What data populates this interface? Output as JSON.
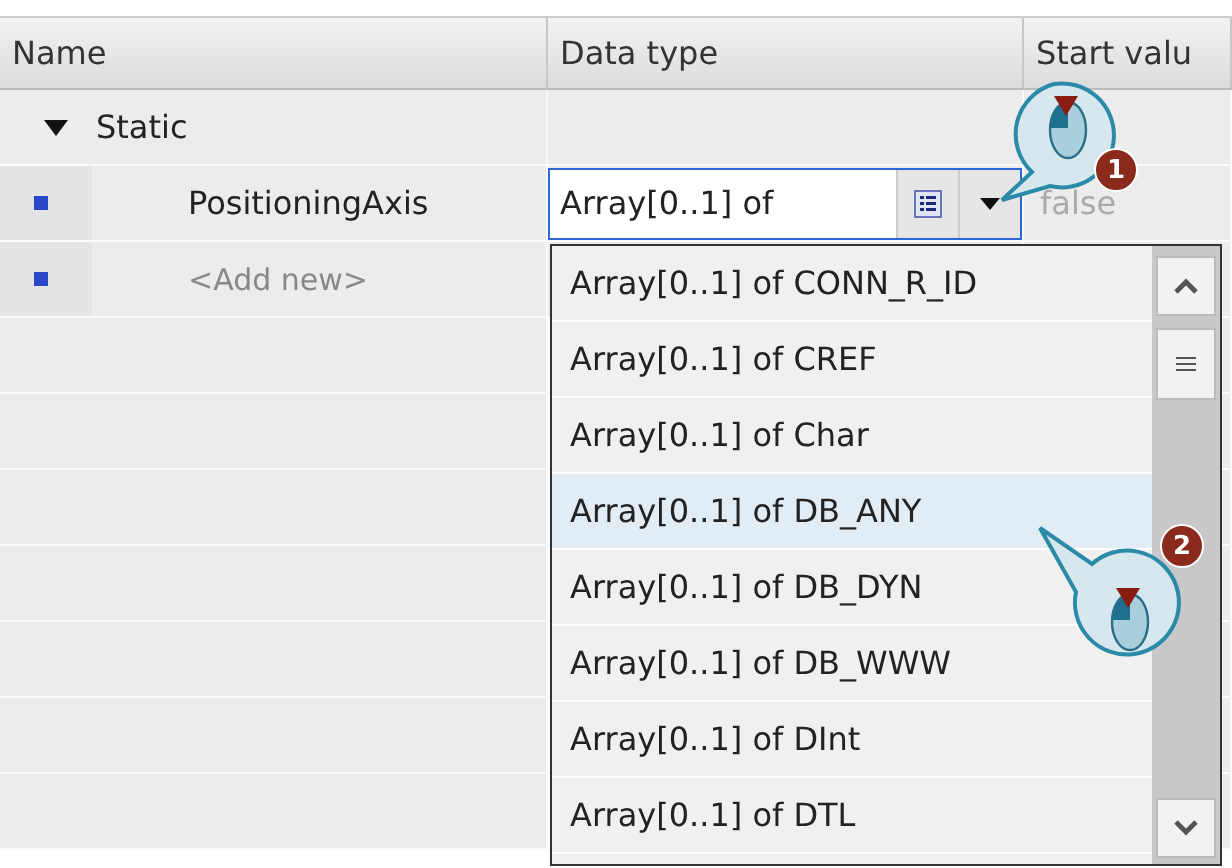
{
  "table": {
    "columns": [
      "Name",
      "Data type",
      "Start valu"
    ],
    "rows": [
      {
        "kind": "section",
        "name": "Static",
        "expanded": true
      },
      {
        "kind": "variable",
        "name": "PositioningAxis",
        "data_type": "Array[0..1] of",
        "start_value": "false"
      },
      {
        "kind": "placeholder",
        "name": "<Add new>"
      }
    ]
  },
  "dropdown": {
    "items": [
      {
        "label": "Array[0..1] of CONN_R_ID",
        "selected": false
      },
      {
        "label": "Array[0..1] of CREF",
        "selected": false
      },
      {
        "label": "Array[0..1] of Char",
        "selected": false
      },
      {
        "label": "Array[0..1] of DB_ANY",
        "selected": true
      },
      {
        "label": "Array[0..1] of DB_DYN",
        "selected": false
      },
      {
        "label": "Array[0..1] of DB_WWW",
        "selected": false
      },
      {
        "label": "Array[0..1] of DInt",
        "selected": false
      },
      {
        "label": "Array[0..1] of DTL",
        "selected": false
      }
    ]
  },
  "callouts": [
    {
      "number": "1"
    },
    {
      "number": "2"
    }
  ]
}
